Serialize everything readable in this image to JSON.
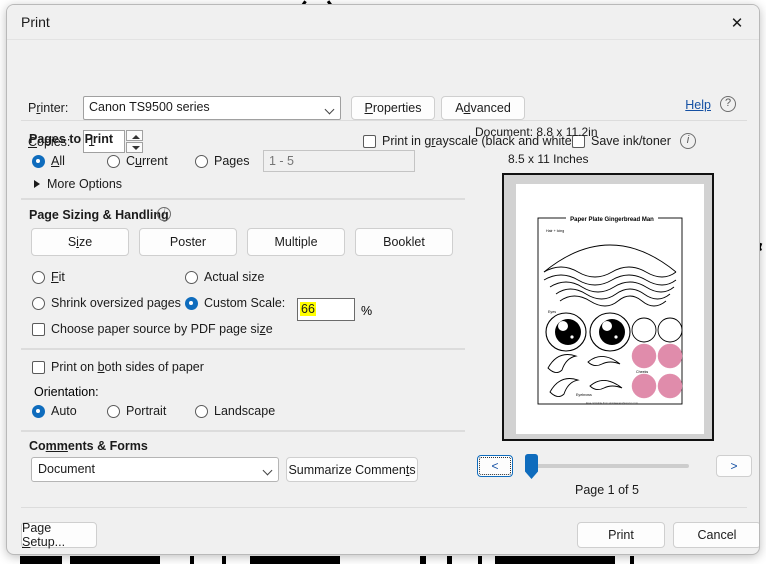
{
  "dialog": {
    "title": "Print",
    "close_icon": "close-icon"
  },
  "printer": {
    "label": "Printer:",
    "selected": "Canon TS9500 series",
    "properties_label": "Properties",
    "advanced_label": "Advanced",
    "help_label": "Help",
    "help_icon": "question-circle-icon",
    "copies_label": "Copies:",
    "copies_value": "1",
    "grayscale_label": "Print in grayscale (black and white)",
    "grayscale_checked": false,
    "saveink_label": "Save ink/toner",
    "saveink_checked": false,
    "info_icon": "info-circle-icon"
  },
  "pages_to_print": {
    "title": "Pages to Print",
    "options": [
      {
        "label": "All",
        "selected": true
      },
      {
        "label": "Current",
        "selected": false
      },
      {
        "label": "Pages",
        "selected": false
      }
    ],
    "range_placeholder": "1 - 5",
    "range_value": "",
    "more_options_label": "More Options",
    "more_options_icon": "caret-right-icon"
  },
  "page_sizing": {
    "title": "Page Sizing & Handling",
    "info_icon": "info-circle-icon",
    "buttons": [
      "Size",
      "Poster",
      "Multiple",
      "Booklet"
    ],
    "options": [
      {
        "label": "Fit",
        "selected": false
      },
      {
        "label": "Actual size",
        "selected": false
      },
      {
        "label": "Shrink oversized pages",
        "selected": false
      },
      {
        "label": "Custom Scale:",
        "selected": true
      }
    ],
    "scale_value": "66",
    "percent_label": "%",
    "paper_source_label": "Choose paper source by PDF page size",
    "paper_source_checked": false,
    "highlight_color": "#ffff00"
  },
  "duplex": {
    "both_sides_label": "Print on both sides of paper",
    "both_sides_checked": false,
    "orientation_label": "Orientation:",
    "orientation_options": [
      {
        "label": "Auto",
        "selected": true
      },
      {
        "label": "Portrait",
        "selected": false
      },
      {
        "label": "Landscape",
        "selected": false
      }
    ]
  },
  "comments_forms": {
    "title": "Comments & Forms",
    "selected": "Document",
    "summarize_label": "Summarize Comments"
  },
  "preview": {
    "document_size": "Document: 8.8 x 11.2in",
    "paper_size": "8.5 x 11 Inches",
    "prev_label": "<",
    "next_label": ">",
    "page_indicator": "Page 1 of 5",
    "artwork_title": "Paper Plate Gingerbread Man",
    "artwork_labels": [
      "Hair + Icing",
      "Eyes",
      "Cheeks",
      "Eyebrows"
    ],
    "cheek_color": "#e08cab"
  },
  "footer": {
    "page_setup_label": "Page Setup...",
    "print_label": "Print",
    "cancel_label": "Cancel"
  },
  "theme": {
    "accent": "#0f6cbd",
    "link": "#1450a3",
    "dialog_bg": "#f0f0f0",
    "backdrop_bg": "#c9c9c9"
  }
}
